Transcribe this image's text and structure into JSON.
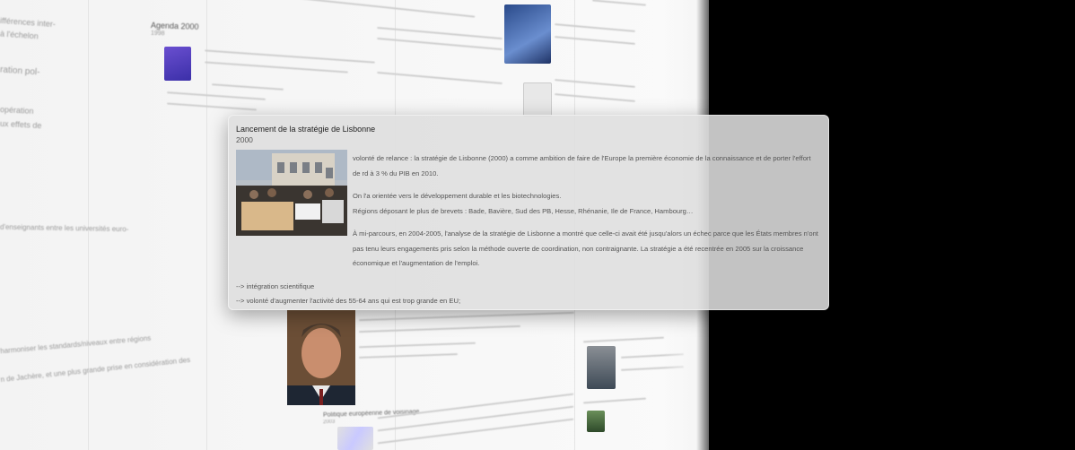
{
  "background": {
    "entries": [
      {
        "title": "Agenda 2000",
        "year": "1998"
      },
      {
        "title": "Politique européenne de voisinage",
        "year": "2003"
      }
    ],
    "left_fragments": [
      "ifférences inter-",
      "à l'échelon",
      "ration pol-",
      "opération",
      "ux effets de",
      "d'enseignants entre les universités euro-",
      "harmoniser les standards/niveaux entre régions",
      "n de Jachère, et une plus grande prise en considération des"
    ]
  },
  "popup": {
    "title": "Lancement de la stratégie de Lisbonne",
    "year": "2000",
    "paragraphs_top": [
      "volonté de relance : la stratégie de Lisbonne (2000) a comme ambition de faire de l'Europe la première économie de la connaissance et de porter l'effort de rd à 3 % du PIB en 2010.",
      "On l'a orientée vers le développement durable et les biotechnologies.",
      "Régions déposant le plus de brevets : Bade, Bavière, Sud des PB, Hesse, Rhénanie, Ile de France, Hambourg…"
    ],
    "paragraphs_bottom": [
      "À mi-parcours, en 2004-2005, l'analyse de la stratégie de Lisbonne a montré que celle-ci avait été jusqu'alors un échec parce que les États membres n'ont pas tenu leurs engagements pris selon la méthode ouverte de coordination, non contraignante. La stratégie a été recentrée en 2005 sur la croissance économique et l'augmentation de l'emploi.",
      "--> intégration scientifique",
      "--> volonté d'augmenter l'activité des 55-64 ans qui est trop grande en EU;"
    ]
  },
  "colors": {
    "page_bg": "#f5f5f5",
    "popup_bg": "#dedede",
    "text": "#555555",
    "title": "#222222"
  }
}
